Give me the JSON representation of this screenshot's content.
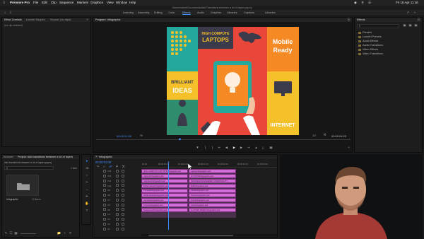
{
  "menubar": {
    "apple_icon": "apple-icon",
    "app": "Premiere Pro",
    "items": [
      "File",
      "Edit",
      "Clip",
      "Sequence",
      "Markers",
      "Graphics",
      "View",
      "Window",
      "Help"
    ],
    "datetime": "Fri 16 Apr  11:16"
  },
  "titlebar": {
    "path": "/Users/robert/Documents/Add Transitions between a lot of layers.prproj"
  },
  "workspaces": [
    "Learning",
    "Assembly",
    "Editing",
    "Color",
    "Effects",
    "Audio",
    "Graphics",
    "Libraries",
    "Captions",
    "Libraries"
  ],
  "workspaces_active": "Effects",
  "effect_controls": {
    "tabs": [
      "Effect Controls",
      "Lumetri Scopes",
      "Source: (no clips)",
      "Audio Clip Mixer"
    ],
    "empty_text": "(no clip selected)"
  },
  "program": {
    "title": "Program: Infographic",
    "timecode_left": "00:00:01:09",
    "fit": "Fit",
    "quality": "1/2",
    "timecode_right": "00:00:04:23"
  },
  "artwork": {
    "high_compute": "HIGH COMPUTE",
    "laptops": "LAPTOPS",
    "mobile": "Mobile",
    "ready": "Ready",
    "brilliant": "BRILLIANT",
    "ideas": "IDEAS",
    "internet": "INTERNET"
  },
  "effects_panel": {
    "title": "Effects",
    "search_placeholder": "",
    "items": [
      "Presets",
      "Lumetri Presets",
      "Audio Effects",
      "Audio Transitions",
      "Video Effects",
      "Video Transitions"
    ]
  },
  "project_panel": {
    "tabs": [
      "Browser",
      "Project: Add transitions between a lot of layers"
    ],
    "file_name": "Add transitions between a lot of layers.prproj",
    "items_count": "1 Item",
    "bin_label": "Infographic",
    "bin_duration": "10 items"
  },
  "timeline": {
    "tab": "Infographic",
    "timecode": "00:00:01:09",
    "ruler": [
      "00:00",
      "00:00:00:15",
      "00:00:01:00",
      "00:00:01:15",
      "00:00:02:00",
      "00:00:02:15",
      "00:00:03:00"
    ],
    "tracks": [
      "V13",
      "V12",
      "V11",
      "V10",
      "V9",
      "V8",
      "V7",
      "V6",
      "V5",
      "V4",
      "V3",
      "V2",
      "V1"
    ],
    "clips_left": [
      "HIGH COMPUTE LAPTOPS Infographic.psd",
      "Laptops/Infographic.psd",
      "Inspiration/Infographic.psd",
      "Brilliant Ideas/Infographic.psd",
      "Pinhead/Infographic.psd",
      "Mobile Ready/Infographic.psd",
      "Internet/Infographic.psd",
      "Person/Infographic.psd",
      "Background/Infographic.psd"
    ],
    "clips_right": [
      "Laptops/Infographic.psd",
      "INTUITIVE/Infographic.psd",
      "IMAGINED ENGINEERED COMMONALITY...",
      "Bulb/Infographic.psd",
      "Hand/Infographic.psd",
      "Phone/Infographic.psd",
      "World/Infographic.psd",
      "Dots/Infographic.psd",
      "CH TOWS PRESS/Infographic.psd"
    ]
  },
  "colors": {
    "accent": "#3f8cff",
    "clip": "#d46ed6",
    "art_green": "#2f8d6e",
    "art_red": "#e8473a",
    "art_yellow": "#f4c12a",
    "art_teal": "#24a89b",
    "art_orange": "#f58a25",
    "art_dark": "#3b3a4a"
  }
}
